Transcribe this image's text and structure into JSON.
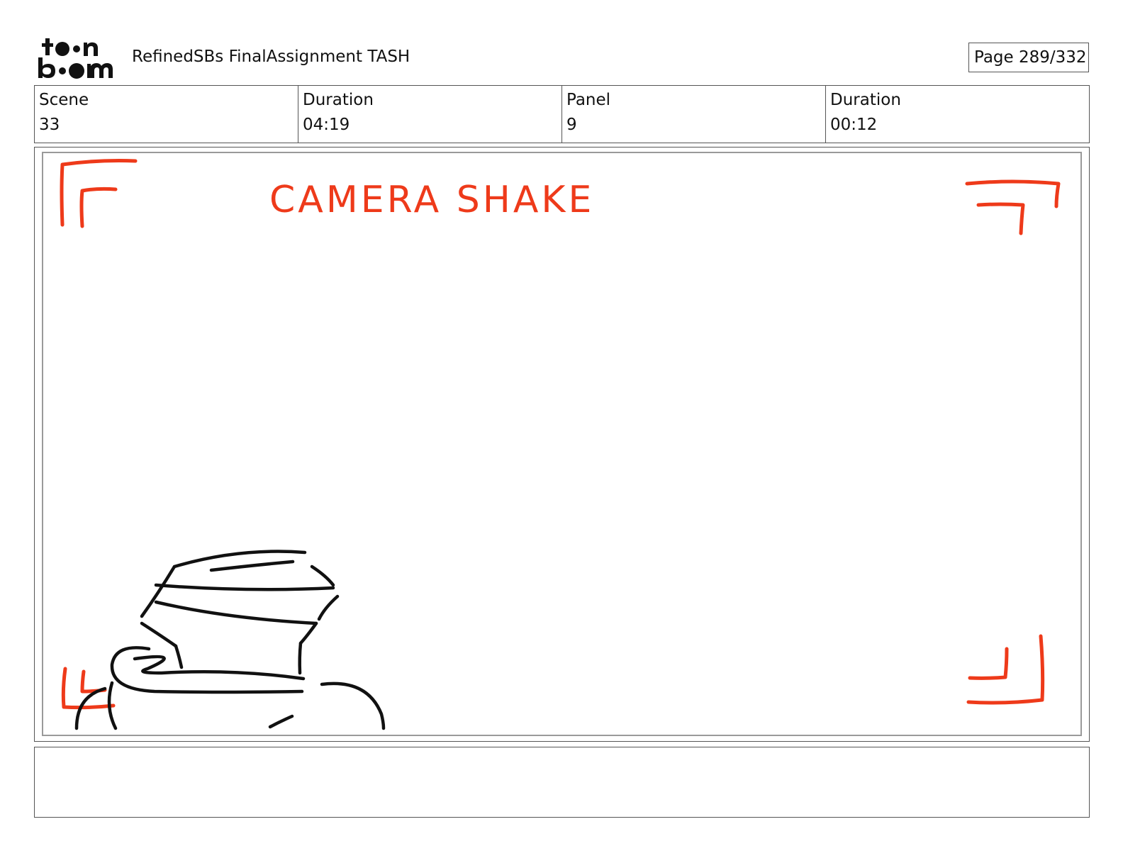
{
  "header": {
    "logo_line_1": "toon",
    "logo_line_2": "boom",
    "document_title": "RefinedSBs FinalAssignment TASH",
    "page_indicator": "Page 289/332"
  },
  "info": {
    "scene_label": "Scene",
    "scene_value": "33",
    "scene_duration_label": "Duration",
    "scene_duration_value": "04:19",
    "panel_label": "Panel",
    "panel_value": "9",
    "panel_duration_label": "Duration",
    "panel_duration_value": "00:12"
  },
  "panel": {
    "annotation": "CAMERA SHAKE",
    "annotation_color": "#ee3a1a",
    "sketch_color": "#111111"
  },
  "notes": {
    "text": ""
  }
}
